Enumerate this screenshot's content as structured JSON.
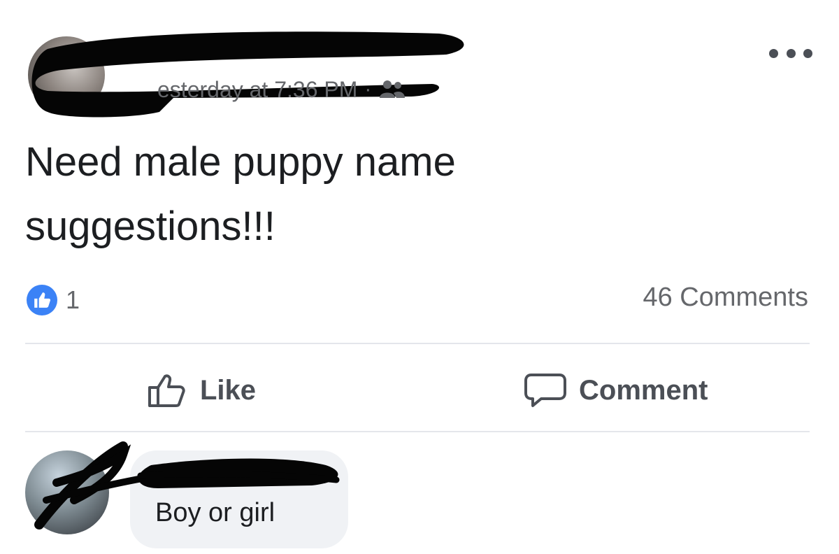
{
  "post": {
    "timestamp": "esterday at 7:36 PM",
    "separator": "·",
    "audience_icon": "friends-icon",
    "text": "Need male puppy name\nsuggestions!!!",
    "reaction_icon": "like-reaction-icon",
    "reaction_count": "1",
    "comments_count": "46 Comments"
  },
  "actions": {
    "like_label": "Like",
    "comment_label": "Comment"
  },
  "comment": {
    "text": "Boy or girl"
  },
  "colors": {
    "like_blue": "#3b82f6",
    "secondary_text": "#65676b",
    "bubble_bg": "#f0f2f5"
  }
}
